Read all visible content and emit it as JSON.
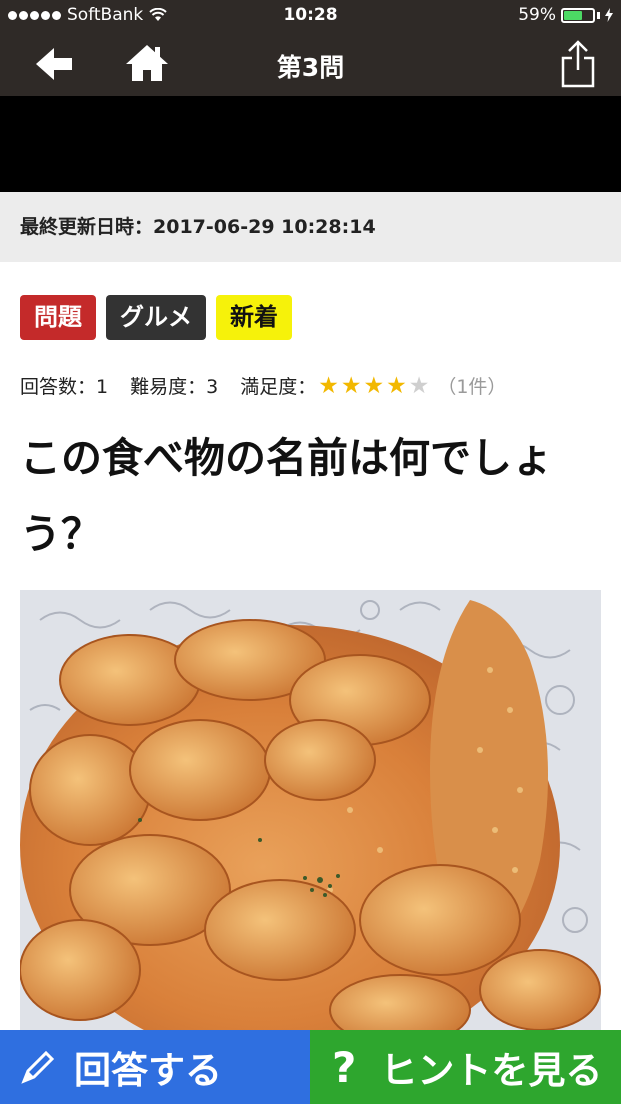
{
  "status_bar": {
    "carrier": "SoftBank",
    "time": "10:28",
    "battery_percent": "59%",
    "battery_level": 0.59
  },
  "nav": {
    "title": "第3問",
    "back_icon": "back-arrow-icon",
    "home_icon": "home-icon",
    "share_icon": "share-icon"
  },
  "updated": {
    "label": "最終更新日時：2017-06-29 10:28:14"
  },
  "tags": [
    {
      "label": "問題",
      "color": "#c42a2a"
    },
    {
      "label": "グルメ",
      "color": "#333333"
    },
    {
      "label": "新着",
      "color": "#f6f20a"
    }
  ],
  "meta": {
    "answers": "回答数：1",
    "difficulty": "難易度：3",
    "satisfaction_label": "満足度：",
    "rating": 4,
    "rating_max": 5,
    "review_count": "（1件）"
  },
  "question": {
    "text": "この食べ物の名前は何でしょう？"
  },
  "buttons": {
    "answer_label": "回答する",
    "hint_label": "ヒントを見る",
    "answer_color": "#2f6fe0",
    "hint_color": "#2ea62e"
  }
}
